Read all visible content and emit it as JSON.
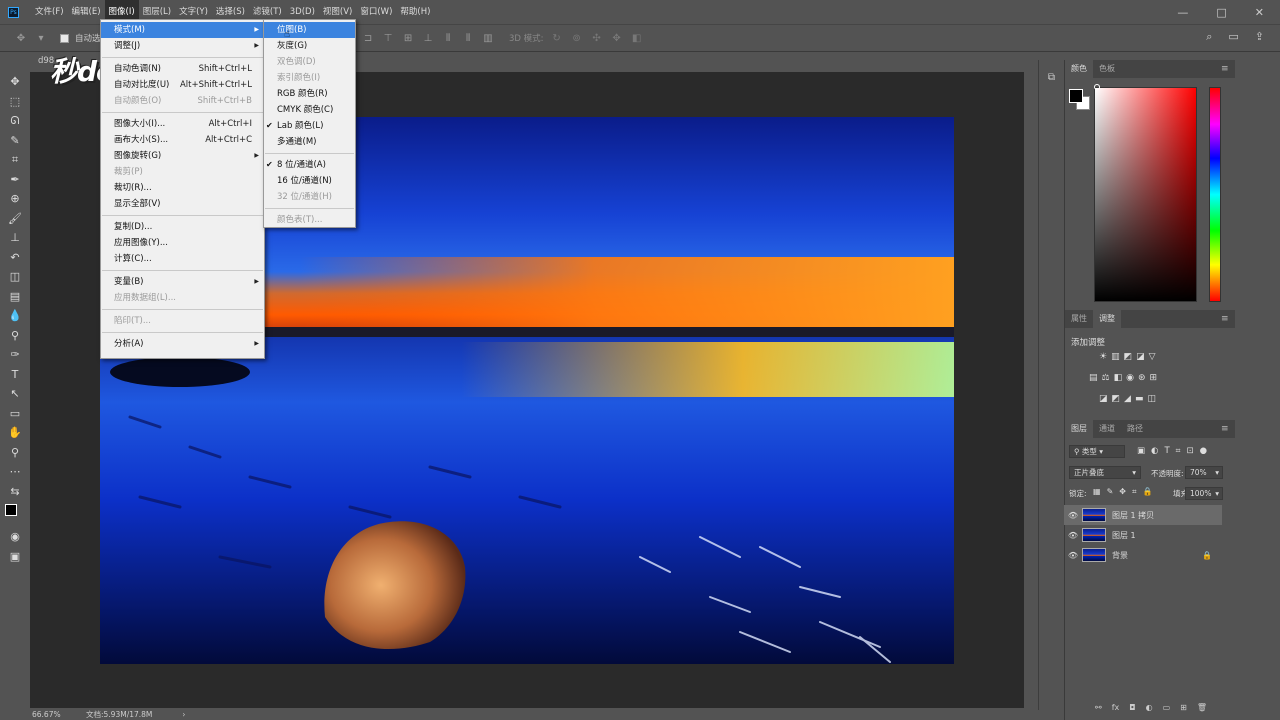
{
  "menubar": {
    "logo": "Ps",
    "items": [
      "文件(F)",
      "编辑(E)",
      "图像(I)",
      "图层(L)",
      "文字(Y)",
      "选择(S)",
      "滤镜(T)",
      "3D(D)",
      "视图(V)",
      "窗口(W)",
      "帮助(H)"
    ],
    "active_index": 2,
    "window_controls": [
      "—",
      "□",
      "✕"
    ]
  },
  "options": {
    "auto_select": "自动选择",
    "mode_3d": "3D 模式:"
  },
  "document": {
    "tab_title": "d98",
    "zoom": "66.67%",
    "doc_info": "文档:5.93M/17.8M"
  },
  "watermark": "秒dong视频",
  "image_menu": {
    "items": [
      {
        "label": "模式(M)",
        "shortcut": "",
        "submenu": true,
        "disabled": false,
        "highlighted": true
      },
      {
        "label": "调整(J)",
        "shortcut": "",
        "submenu": true,
        "disabled": false,
        "highlighted": false
      },
      {
        "sep": true
      },
      {
        "label": "自动色调(N)",
        "shortcut": "Shift+Ctrl+L",
        "submenu": false,
        "disabled": false,
        "highlighted": false
      },
      {
        "label": "自动对比度(U)",
        "shortcut": "Alt+Shift+Ctrl+L",
        "submenu": false,
        "disabled": false,
        "highlighted": false
      },
      {
        "label": "自动颜色(O)",
        "shortcut": "Shift+Ctrl+B",
        "submenu": false,
        "disabled": true,
        "highlighted": false
      },
      {
        "sep": true
      },
      {
        "label": "图像大小(I)...",
        "shortcut": "Alt+Ctrl+I",
        "submenu": false,
        "disabled": false,
        "highlighted": false
      },
      {
        "label": "画布大小(S)...",
        "shortcut": "Alt+Ctrl+C",
        "submenu": false,
        "disabled": false,
        "highlighted": false
      },
      {
        "label": "图像旋转(G)",
        "shortcut": "",
        "submenu": true,
        "disabled": false,
        "highlighted": false
      },
      {
        "label": "裁剪(P)",
        "shortcut": "",
        "submenu": false,
        "disabled": true,
        "highlighted": false
      },
      {
        "label": "裁切(R)...",
        "shortcut": "",
        "submenu": false,
        "disabled": false,
        "highlighted": false
      },
      {
        "label": "显示全部(V)",
        "shortcut": "",
        "submenu": false,
        "disabled": false,
        "highlighted": false
      },
      {
        "sep": true
      },
      {
        "label": "复制(D)...",
        "shortcut": "",
        "submenu": false,
        "disabled": false,
        "highlighted": false
      },
      {
        "label": "应用图像(Y)...",
        "shortcut": "",
        "submenu": false,
        "disabled": false,
        "highlighted": false
      },
      {
        "label": "计算(C)...",
        "shortcut": "",
        "submenu": false,
        "disabled": false,
        "highlighted": false
      },
      {
        "sep": true
      },
      {
        "label": "变量(B)",
        "shortcut": "",
        "submenu": true,
        "disabled": false,
        "highlighted": false
      },
      {
        "label": "应用数据组(L)...",
        "shortcut": "",
        "submenu": false,
        "disabled": true,
        "highlighted": false
      },
      {
        "sep": true
      },
      {
        "label": "陷印(T)...",
        "shortcut": "",
        "submenu": false,
        "disabled": true,
        "highlighted": false
      },
      {
        "sep": true
      },
      {
        "label": "分析(A)",
        "shortcut": "",
        "submenu": true,
        "disabled": false,
        "highlighted": false
      }
    ]
  },
  "mode_submenu": {
    "items": [
      {
        "label": "位图(B)",
        "checked": false,
        "disabled": true,
        "highlighted": true
      },
      {
        "label": "灰度(G)",
        "checked": false,
        "disabled": false,
        "highlighted": false
      },
      {
        "label": "双色调(D)",
        "checked": false,
        "disabled": true,
        "highlighted": false
      },
      {
        "label": "索引颜色(I)",
        "checked": false,
        "disabled": true,
        "highlighted": false
      },
      {
        "label": "RGB 颜色(R)",
        "checked": false,
        "disabled": false,
        "highlighted": false
      },
      {
        "label": "CMYK 颜色(C)",
        "checked": false,
        "disabled": false,
        "highlighted": false
      },
      {
        "label": "Lab 颜色(L)",
        "checked": true,
        "disabled": false,
        "highlighted": false
      },
      {
        "label": "多通道(M)",
        "checked": false,
        "disabled": false,
        "highlighted": false
      },
      {
        "sep": true
      },
      {
        "label": "8 位/通道(A)",
        "checked": true,
        "disabled": false,
        "highlighted": false
      },
      {
        "label": "16 位/通道(N)",
        "checked": false,
        "disabled": false,
        "highlighted": false
      },
      {
        "label": "32 位/通道(H)",
        "checked": false,
        "disabled": true,
        "highlighted": false
      },
      {
        "sep": true
      },
      {
        "label": "颜色表(T)...",
        "checked": false,
        "disabled": true,
        "highlighted": false
      }
    ]
  },
  "panels": {
    "color_tabs": [
      "颜色",
      "色板"
    ],
    "props_tabs": [
      "属性",
      "调整"
    ],
    "adjust_title": "添加调整",
    "layers_tabs": [
      "图层",
      "通道",
      "路径"
    ],
    "filter_kind": "类型",
    "blend_mode": "正片叠底",
    "opacity_label": "不透明度:",
    "opacity_value": "70%",
    "lock_label": "锁定:",
    "fill_label": "填充:",
    "fill_value": "100%",
    "layers": [
      {
        "name": "图层 1 拷贝",
        "selected": true,
        "locked": false
      },
      {
        "name": "图层 1",
        "selected": false,
        "locked": false
      },
      {
        "name": "背景",
        "selected": false,
        "locked": true
      }
    ]
  },
  "colors": {
    "menu_highlight": "#3c84df",
    "panel_bg": "#535353",
    "canvas_bg": "#2a2a2a"
  }
}
